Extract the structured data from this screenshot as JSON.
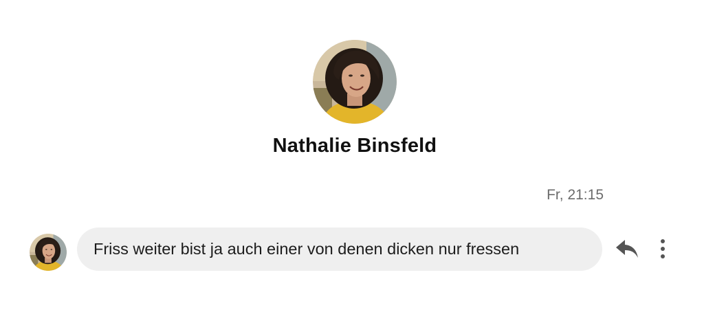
{
  "profile": {
    "name": "Nathalie Binsfeld",
    "avatar_icon": "user-photo-avatar"
  },
  "conversation": {
    "timestamp": "Fr, 21:15",
    "messages": [
      {
        "sender": "Nathalie Binsfeld",
        "text": "Friss weiter bist ja auch einer von denen dicken nur fressen"
      }
    ]
  },
  "actions": {
    "reply_icon": "reply-icon",
    "more_icon": "more-vertical-icon"
  },
  "colors": {
    "background": "#ffffff",
    "bubble": "#efefef",
    "text": "#1c1c1c",
    "timestamp": "#6b6b6b",
    "icon": "#555555"
  }
}
